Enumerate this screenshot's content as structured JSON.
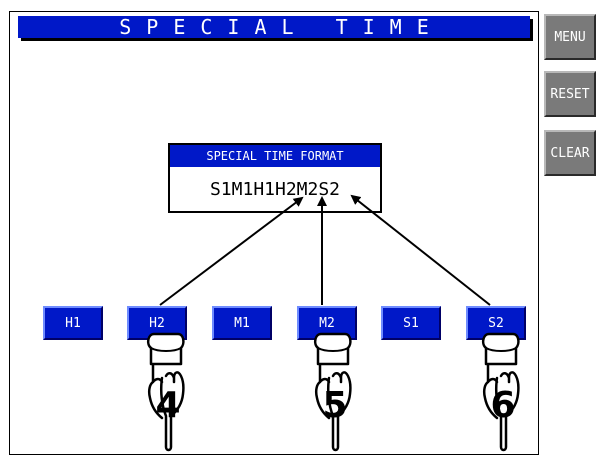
{
  "title": "SPECIAL TIME",
  "side_buttons": {
    "menu": "MENU",
    "reset": "RESET",
    "clear": "CLEAR"
  },
  "format": {
    "header": "SPECIAL TIME FORMAT",
    "value": "S1M1H1H2M2S2"
  },
  "keys": [
    "H1",
    "H2",
    "M1",
    "M2",
    "S1",
    "S2"
  ],
  "steps": [
    "4",
    "5",
    "6"
  ],
  "colors": {
    "panel_blue": "#0018c8",
    "side_button_gray": "#7a7a7a"
  },
  "icons": {
    "pointer": "pointing-hand-icon",
    "arrow": "arrow-icon"
  }
}
